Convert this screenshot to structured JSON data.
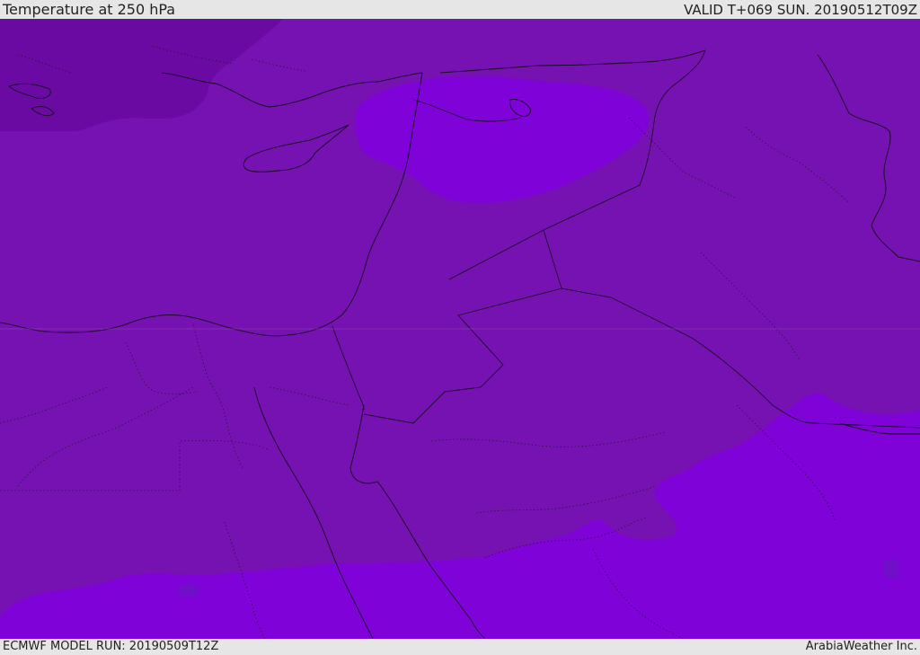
{
  "header": {
    "title": "Temperature at 250 hPa",
    "valid": "VALID T+069 SUN. 20190512T09Z"
  },
  "footer": {
    "model_run": "ECMWF MODEL RUN: 20190509T12Z",
    "credit": "ArabiaWeather Inc."
  },
  "colors": {
    "base_band": "#7612b2",
    "cold_band": "#6a0aa2",
    "warm_band": "#7f02d8",
    "coastline": "#1a0a26",
    "border": "#1a0a26"
  }
}
